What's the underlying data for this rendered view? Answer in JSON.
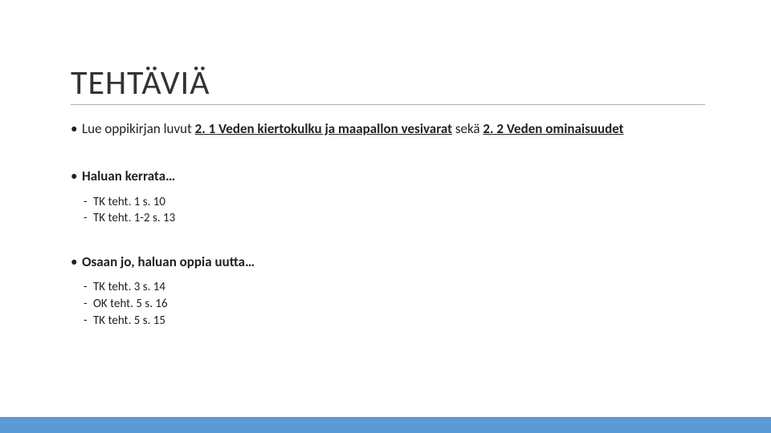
{
  "title": "TEHTÄVIÄ",
  "intro": {
    "prefix": "Lue oppikirjan luvut ",
    "bold1": "2. 1 Veden kiertokulku ja maapallon vesivarat",
    "mid": " sekä ",
    "bold2": "2. 2 Veden ominaisuudet"
  },
  "section1": {
    "heading": "Haluan kerrata…",
    "items": [
      "TK teht. 1 s. 10",
      "TK teht. 1-2 s. 13"
    ]
  },
  "section2": {
    "heading": "Osaan jo, haluan oppia uutta…",
    "items": [
      "TK teht. 3 s. 14",
      "OK teht. 5 s. 16",
      "TK teht. 5 s. 15"
    ]
  }
}
